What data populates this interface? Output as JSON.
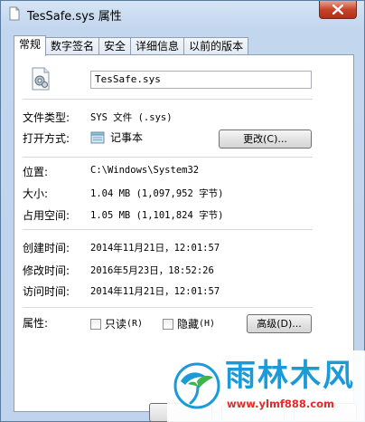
{
  "window": {
    "title": "TesSafe.sys 属性"
  },
  "tabs": [
    {
      "label": "常规",
      "active": true
    },
    {
      "label": "数字签名",
      "active": false
    },
    {
      "label": "安全",
      "active": false
    },
    {
      "label": "详细信息",
      "active": false
    },
    {
      "label": "以前的版本",
      "active": false
    }
  ],
  "general": {
    "file_name": "TesSafe.sys",
    "file_type_label": "文件类型:",
    "file_type_value": "SYS 文件 (.sys)",
    "opens_with_label": "打开方式:",
    "opens_with_app": "记事本",
    "change_button": "更改(C)...",
    "location_label": "位置:",
    "location_value": "C:\\Windows\\System32",
    "size_label": "大小:",
    "size_value": "1.04 MB (1,097,952 字节)",
    "size_on_disk_label": "占用空间:",
    "size_on_disk_value": "1.05 MB (1,101,824 字节)",
    "created_label": "创建时间:",
    "created_value": "2014年11月21日，12:01:57",
    "modified_label": "修改时间:",
    "modified_value": "2016年5月23日，18:52:26",
    "accessed_label": "访问时间:",
    "accessed_value": "2014年11月21日，12:01:57",
    "attributes_label": "属性:",
    "readonly_label": "只读",
    "readonly_key": "(R)",
    "readonly_checked": false,
    "hidden_label": "隐藏",
    "hidden_key": "(H)",
    "hidden_checked": false,
    "advanced_button": "高级(D)..."
  },
  "watermark": {
    "brand": "雨林木风",
    "url": "www.ylmf888.com",
    "brand_color": "#1a9bd7",
    "url_color": "#e52b2b"
  },
  "colors": {
    "title_bar": "#c2d6ee",
    "close_button": "#c7452c"
  }
}
